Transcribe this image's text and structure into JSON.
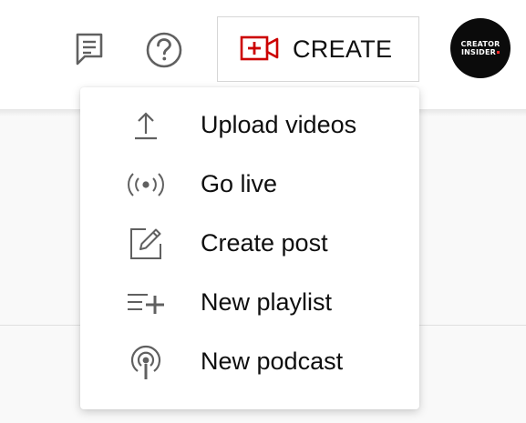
{
  "header": {
    "create_label": "CREATE",
    "avatar_line1": "CREATOR",
    "avatar_line2": "INSIDER"
  },
  "menu": {
    "items": [
      {
        "label": "Upload videos",
        "icon": "upload-icon"
      },
      {
        "label": "Go live",
        "icon": "live-broadcast-icon"
      },
      {
        "label": "Create post",
        "icon": "edit-post-icon"
      },
      {
        "label": "New playlist",
        "icon": "add-playlist-icon"
      },
      {
        "label": "New podcast",
        "icon": "podcast-icon"
      }
    ]
  },
  "colors": {
    "accent_red": "#cc0000",
    "text": "#0f0f0f",
    "icon_gray": "#606060"
  }
}
